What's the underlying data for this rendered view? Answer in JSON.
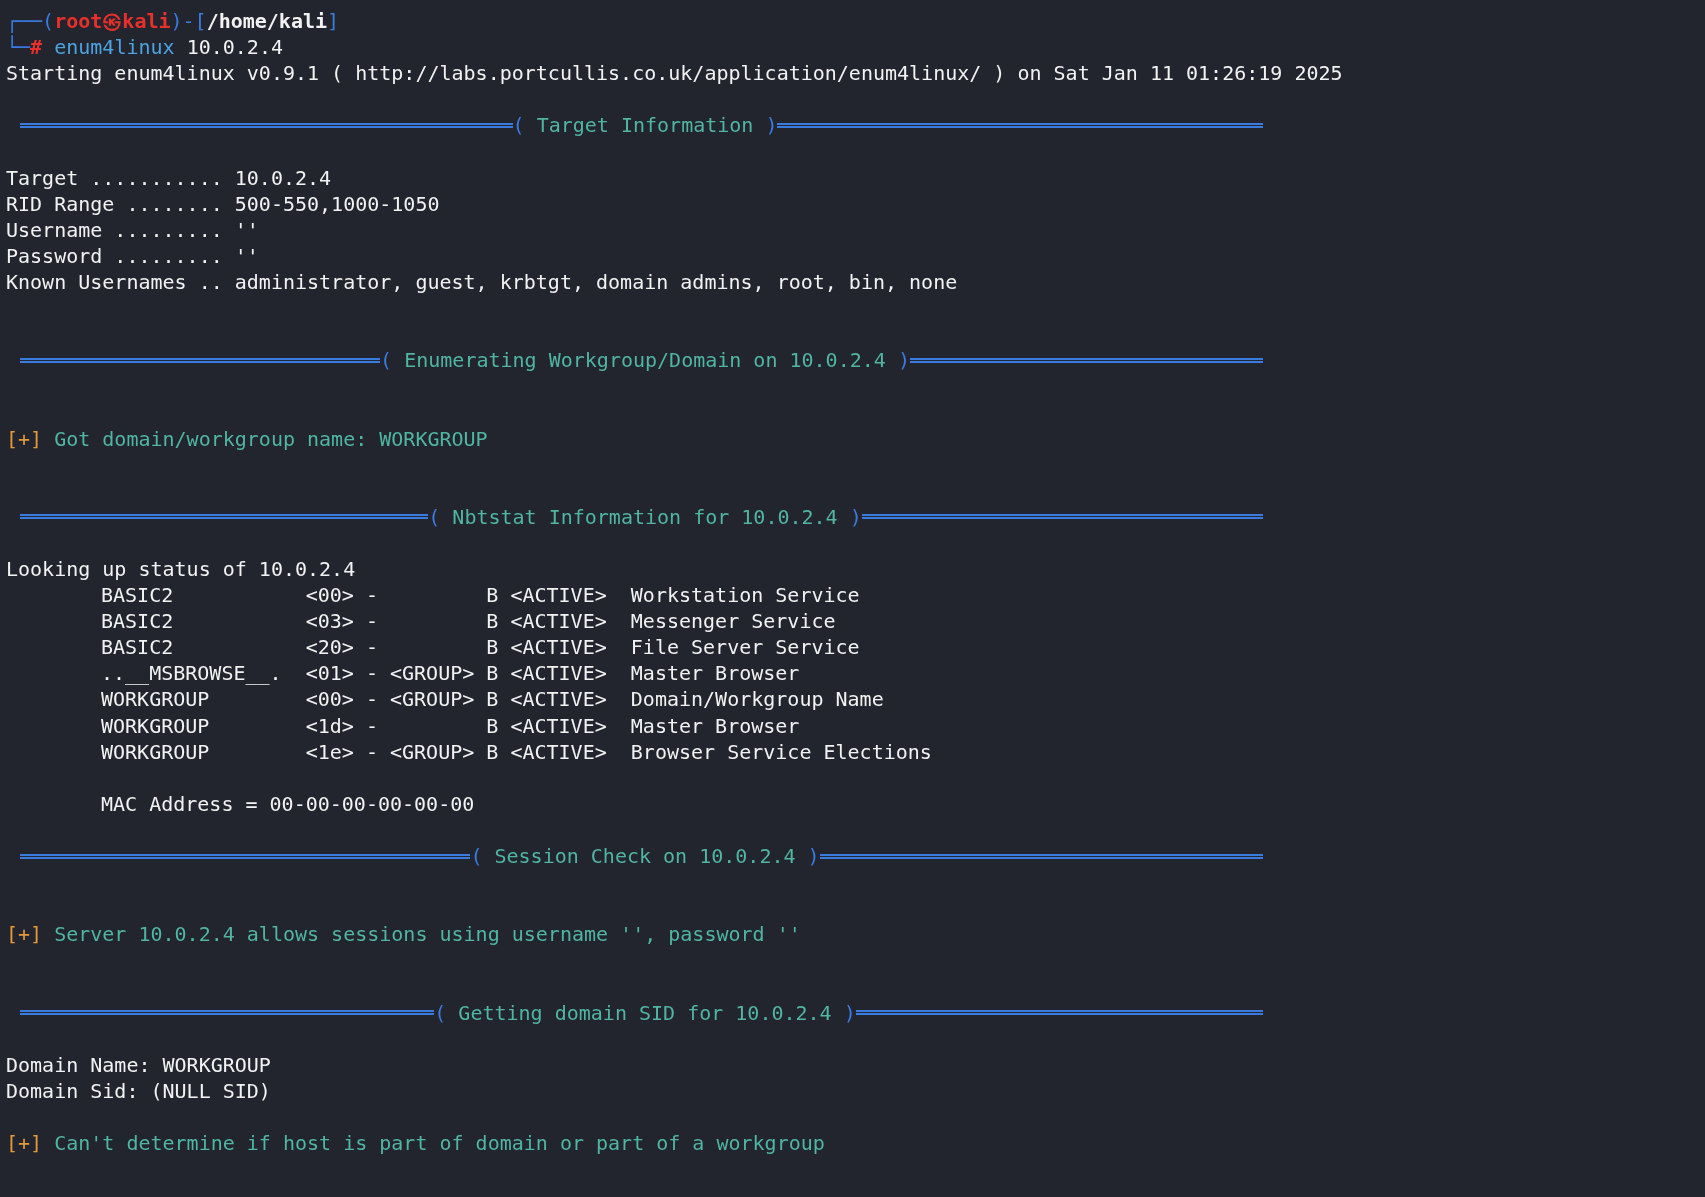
{
  "prompt": {
    "frame_top": "┌──(",
    "user": "root㉿kali",
    "frame_mid": ")-[",
    "path": "/home/kali",
    "frame_end": "]",
    "frame_bottom": "└─",
    "symbol": "#",
    "command": "enum4linux",
    "args": "10.0.2.4"
  },
  "brackets": [
    "(",
    ")"
  ],
  "lines": [
    {
      "kind": "text",
      "text": "Starting enum4linux v0.9.1 ( http://labs.portcullis.co.uk/application/enum4linux/ ) on Sat Jan 11 01:26:19 2025"
    },
    {
      "kind": "blank"
    },
    {
      "kind": "separator",
      "title": "Target Information"
    },
    {
      "kind": "blank"
    },
    {
      "kind": "text",
      "text": "Target ........... 10.0.2.4"
    },
    {
      "kind": "text",
      "text": "RID Range ........ 500-550,1000-1050"
    },
    {
      "kind": "text",
      "text": "Username ......... ''"
    },
    {
      "kind": "text",
      "text": "Password ......... ''"
    },
    {
      "kind": "text",
      "text": "Known Usernames .. administrator, guest, krbtgt, domain admins, root, bin, none"
    },
    {
      "kind": "blank"
    },
    {
      "kind": "blank"
    },
    {
      "kind": "separator",
      "title": "Enumerating Workgroup/Domain on 10.0.2.4"
    },
    {
      "kind": "blank"
    },
    {
      "kind": "blank"
    },
    {
      "kind": "status",
      "marker": "[+]",
      "text": "Got domain/workgroup name: WORKGROUP"
    },
    {
      "kind": "blank"
    },
    {
      "kind": "blank"
    },
    {
      "kind": "separator",
      "title": "Nbtstat Information for 10.0.2.4"
    },
    {
      "kind": "blank"
    },
    {
      "kind": "text",
      "text": "Looking up status of 10.0.2.4"
    },
    {
      "kind": "indented",
      "text": "BASIC2           <00> -         B <ACTIVE>  Workstation Service"
    },
    {
      "kind": "indented",
      "text": "BASIC2           <03> -         B <ACTIVE>  Messenger Service"
    },
    {
      "kind": "indented",
      "text": "BASIC2           <20> -         B <ACTIVE>  File Server Service"
    },
    {
      "kind": "indented",
      "text": "..__MSBROWSE__.  <01> - <GROUP> B <ACTIVE>  Master Browser"
    },
    {
      "kind": "indented",
      "text": "WORKGROUP        <00> - <GROUP> B <ACTIVE>  Domain/Workgroup Name"
    },
    {
      "kind": "indented",
      "text": "WORKGROUP        <1d> -         B <ACTIVE>  Master Browser"
    },
    {
      "kind": "indented",
      "text": "WORKGROUP        <1e> - <GROUP> B <ACTIVE>  Browser Service Elections"
    },
    {
      "kind": "blank"
    },
    {
      "kind": "indented",
      "text": "MAC Address = 00-00-00-00-00-00"
    },
    {
      "kind": "blank"
    },
    {
      "kind": "separator",
      "title": "Session Check on 10.0.2.4"
    },
    {
      "kind": "blank"
    },
    {
      "kind": "blank"
    },
    {
      "kind": "status",
      "marker": "[+]",
      "text": "Server 10.0.2.4 allows sessions using username '', password ''"
    },
    {
      "kind": "blank"
    },
    {
      "kind": "blank"
    },
    {
      "kind": "separator",
      "title": "Getting domain SID for 10.0.2.4"
    },
    {
      "kind": "blank"
    },
    {
      "kind": "text",
      "text": "Domain Name: WORKGROUP"
    },
    {
      "kind": "text",
      "text": "Domain Sid: (NULL SID)"
    },
    {
      "kind": "blank"
    },
    {
      "kind": "status",
      "marker": "[+]",
      "text": "Can't determine if host is part of domain or part of a workgroup"
    }
  ]
}
